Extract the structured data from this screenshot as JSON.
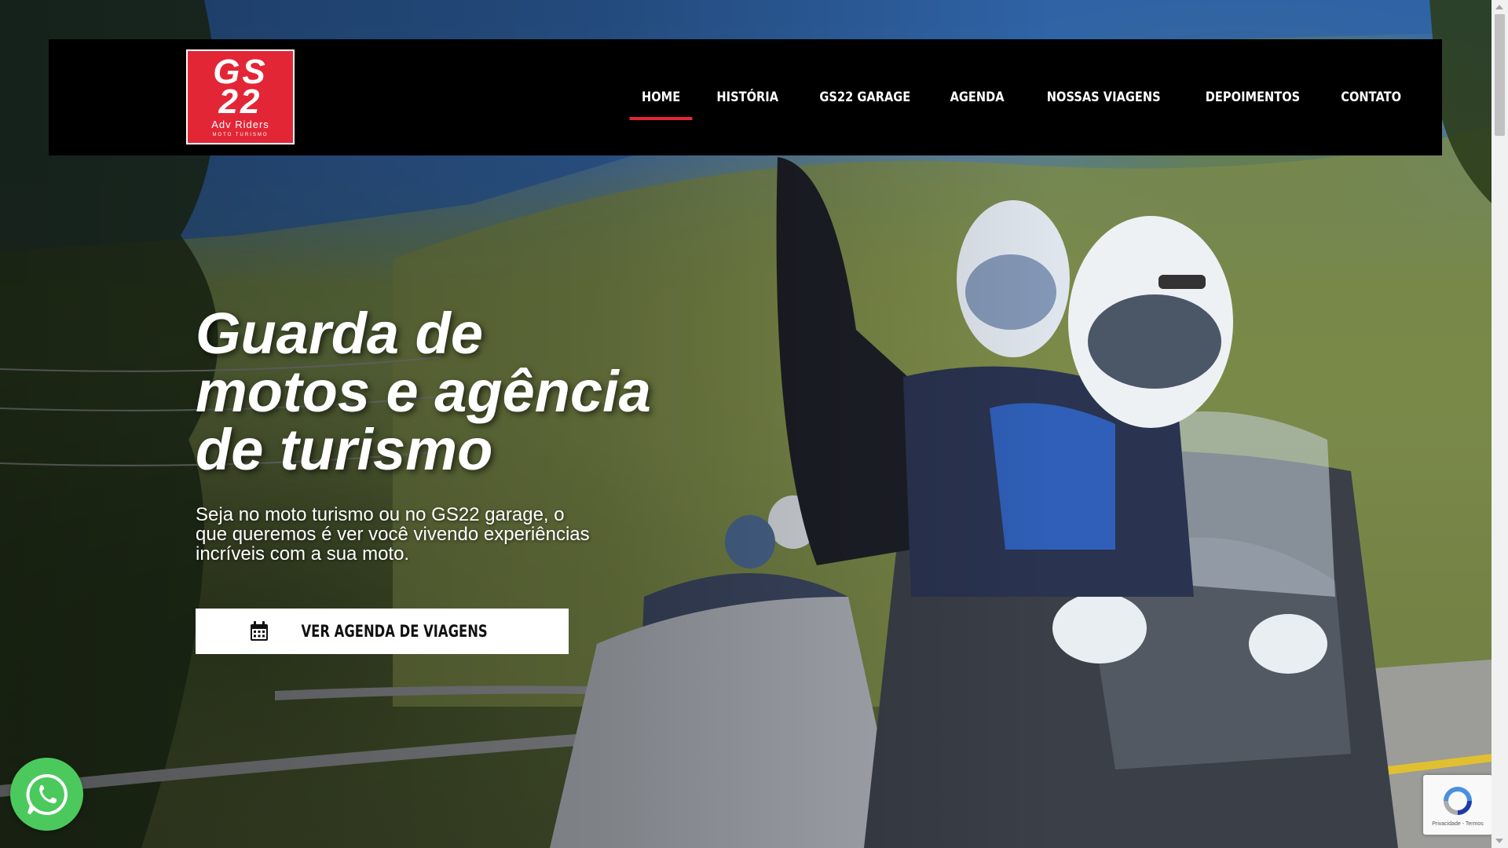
{
  "logo": {
    "line1": "GS",
    "line2": "22",
    "line3": "Adv Riders",
    "line4": "MOTO TURISMO"
  },
  "nav": {
    "items": [
      {
        "label": "HOME",
        "active": true
      },
      {
        "label": "HISTÓRIA",
        "active": false
      },
      {
        "label": "GS22 GARAGE",
        "active": false
      },
      {
        "label": "AGENDA",
        "active": false
      },
      {
        "label": "NOSSAS VIAGENS",
        "active": false
      },
      {
        "label": "DEPOIMENTOS",
        "active": false
      },
      {
        "label": "CONTATO",
        "active": false
      }
    ],
    "active_color": "#e32636"
  },
  "hero": {
    "headline_lines": [
      "Guarda de",
      "motos e agência",
      "de turismo"
    ],
    "subtext_lines": [
      "Seja no moto turismo ou no GS22 garage, o",
      "que queremos é ver você vivendo experiências",
      "incríveis com a sua moto."
    ],
    "cta_label": "VER AGENDA DE VIAGENS",
    "cta_icon": "calendar-icon"
  },
  "widgets": {
    "whatsapp_icon": "whatsapp-icon",
    "whatsapp_color": "#4cc95c",
    "recaptcha_icon": "recaptcha-icon",
    "recaptcha_terms": "Privacidade - Termos"
  },
  "colors": {
    "brand": "#e32636",
    "header_bg": "#000000"
  }
}
